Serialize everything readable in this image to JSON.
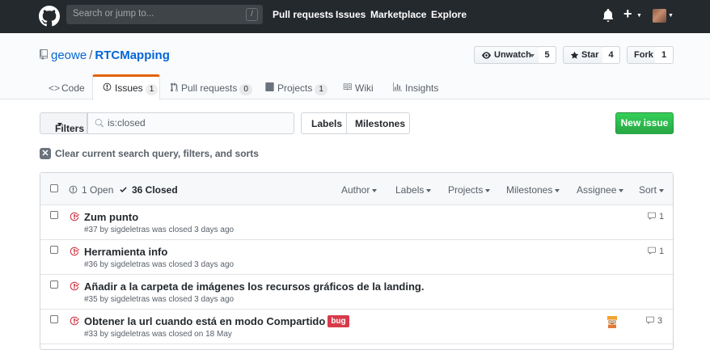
{
  "header": {
    "search_placeholder": "Search or jump to...",
    "slash_key": "/",
    "nav": [
      "Pull requests",
      "Issues",
      "Marketplace",
      "Explore"
    ],
    "plus": "+"
  },
  "repo": {
    "owner": "geowe",
    "separator": "/",
    "name": "RTCMapping",
    "watch_label": "Unwatch",
    "watch_count": "5",
    "star_label": "Star",
    "star_count": "4",
    "fork_label": "Fork",
    "fork_count": "1"
  },
  "tabs": [
    {
      "label": "Code",
      "count": ""
    },
    {
      "label": "Issues",
      "count": "1"
    },
    {
      "label": "Pull requests",
      "count": "0"
    },
    {
      "label": "Projects",
      "count": "1"
    },
    {
      "label": "Wiki",
      "count": ""
    },
    {
      "label": "Insights",
      "count": ""
    }
  ],
  "filterbar": {
    "filters_label": "Filters",
    "search_value": "is:closed",
    "labels_label": "Labels",
    "milestones_label": "Milestones",
    "new_issue_label": "New issue",
    "clear_text": "Clear current search query, filters, and sorts",
    "clear_icon": "✕"
  },
  "list_header": {
    "open_label": "1 Open",
    "closed_label": "36 Closed",
    "filters": [
      "Author",
      "Labels",
      "Projects",
      "Milestones",
      "Assignee",
      "Sort"
    ]
  },
  "issues": [
    {
      "title": "Zum punto",
      "meta": "#37 by sigdeletras was closed 3 days ago",
      "comments": "1",
      "label": "",
      "has_assignee": false
    },
    {
      "title": "Herramienta info",
      "meta": "#36 by sigdeletras was closed 3 days ago",
      "comments": "1",
      "label": "",
      "has_assignee": false
    },
    {
      "title": "Añadir a la carpeta de imágenes los recursos gráficos de la landing.",
      "meta": "#35 by sigdeletras was closed 3 days ago",
      "comments": "",
      "label": "",
      "has_assignee": false
    },
    {
      "title": "Obtener la url cuando está en modo Compartido",
      "meta": "#33 by sigdeletras was closed on 18 May",
      "comments": "3",
      "label": "bug",
      "has_assignee": true
    }
  ],
  "colors": {
    "header_bg": "#24292e",
    "link": "#0366d6",
    "closed_red": "#cb2431",
    "green": "#28a745",
    "tab_accent": "#e36209",
    "bug_label": "#d73a4a"
  },
  "icons": {
    "logo": "github-mark-icon",
    "notifications": "bell-icon",
    "repo": "repo-icon",
    "watch": "eye-icon",
    "star": "star-icon",
    "closed_issue": "issue-closed-icon",
    "comment": "comment-icon",
    "search": "search-icon"
  }
}
